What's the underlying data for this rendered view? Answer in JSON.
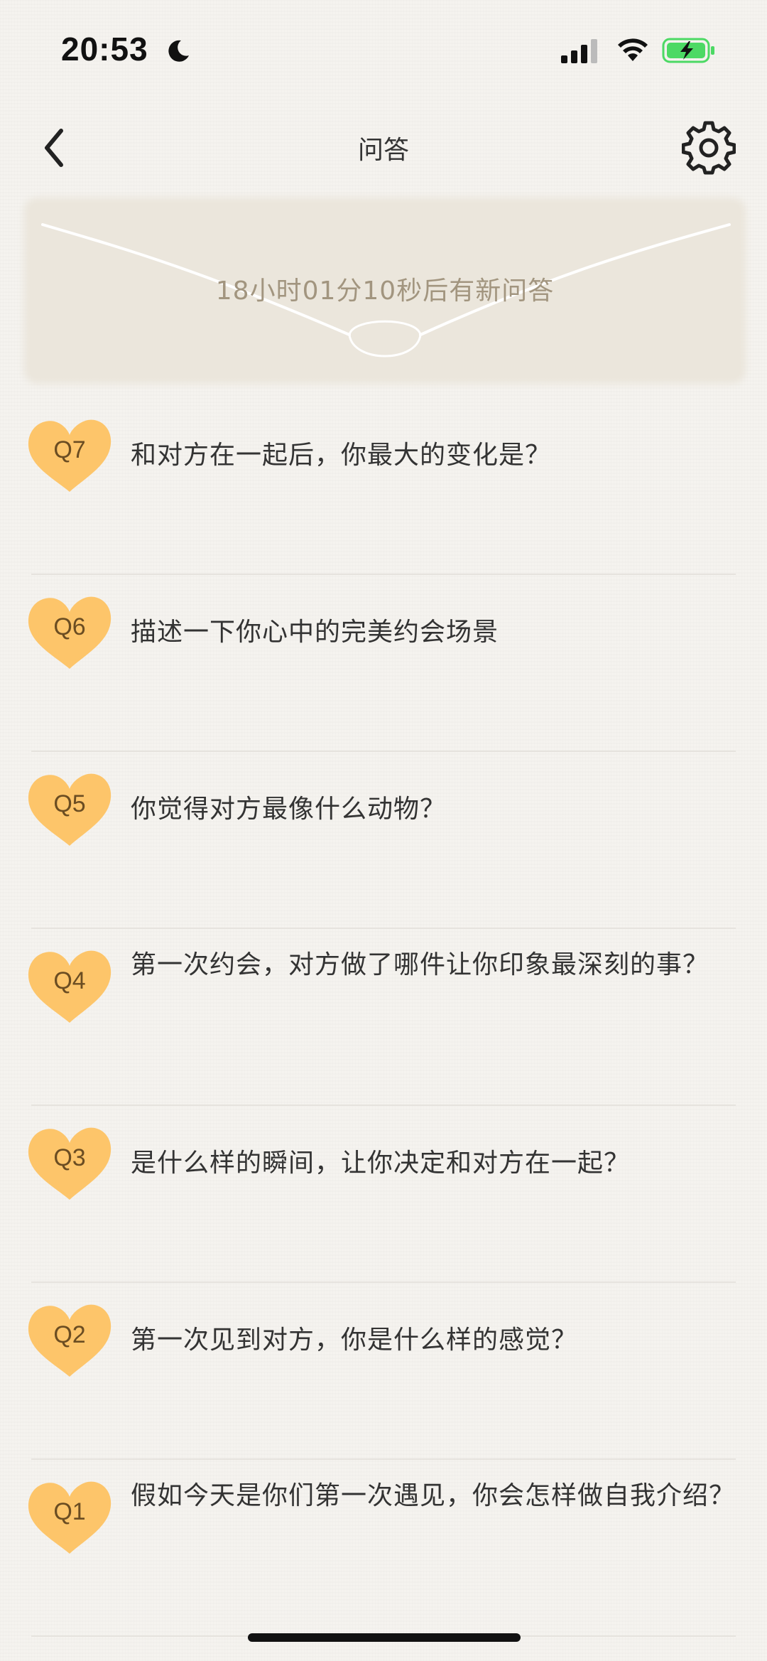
{
  "status_bar": {
    "time": "20:53"
  },
  "nav": {
    "title": "问答"
  },
  "banner": {
    "countdown_text": "18小时01分10秒后有新问答"
  },
  "questions": [
    {
      "badge": "Q7",
      "text": "和对方在一起后，你最大的变化是？"
    },
    {
      "badge": "Q6",
      "text": "描述一下你心中的完美约会场景"
    },
    {
      "badge": "Q5",
      "text": "你觉得对方最像什么动物？"
    },
    {
      "badge": "Q4",
      "text": "第一次约会，对方做了哪件让你印象最深刻的事？"
    },
    {
      "badge": "Q3",
      "text": "是什么样的瞬间，让你决定和对方在一起？"
    },
    {
      "badge": "Q2",
      "text": "第一次见到对方，你是什么样的感觉？"
    },
    {
      "badge": "Q1",
      "text": "假如今天是你们第一次遇见，你会怎样做自我介绍？"
    }
  ],
  "colors": {
    "badge": "#fdc56a",
    "banner": "#ebe6dc",
    "banner_text": "#a2957f",
    "battery_fill": "#4cd964"
  }
}
